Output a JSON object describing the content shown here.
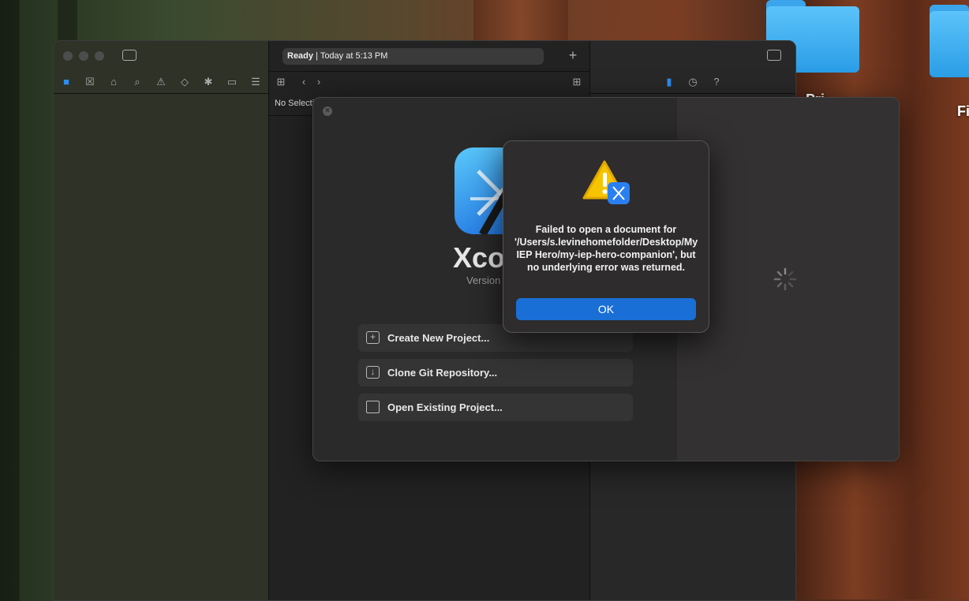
{
  "desktop": {
    "folder_labels": [
      "Pri",
      "Fi"
    ]
  },
  "xcode_window": {
    "status": {
      "state": "Ready",
      "separator": "|",
      "timestamp": "Today at 5:13 PM"
    },
    "navigator_icons": [
      "folder-icon",
      "source-control-icon",
      "bookmark-icon",
      "search-icon",
      "issue-icon",
      "test-icon",
      "debug-icon",
      "breakpoint-icon",
      "report-icon"
    ],
    "editor": {
      "no_selection": "No Selection"
    },
    "inspector_icons": [
      "file-inspector-icon",
      "history-icon",
      "help-icon"
    ]
  },
  "welcome": {
    "app_name": "Xcode",
    "version_label": "Version",
    "actions": [
      {
        "label": "Create New Project...",
        "icon": "plus-square-icon"
      },
      {
        "label": "Clone Git Repository...",
        "icon": "download-tray-icon"
      },
      {
        "label": "Open Existing Project...",
        "icon": "folder-icon"
      }
    ]
  },
  "alert": {
    "message": "Failed to open a document for '/Users/s.levinehomefolder/Desktop/My IEP Hero/my-iep-hero-companion', but no underlying error was returned.",
    "ok_label": "OK"
  },
  "colors": {
    "accent": "#1a6fd6",
    "folder_blue": "#3aa5ea",
    "warning_yellow": "#f7c400"
  }
}
